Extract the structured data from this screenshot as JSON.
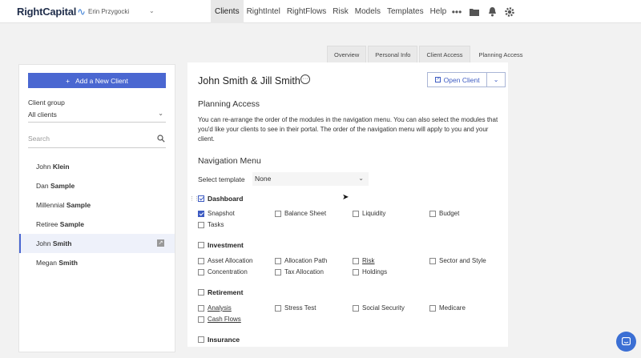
{
  "app": {
    "logo": "RightCapital",
    "user": "Erin Przygocki"
  },
  "nav": {
    "items": [
      "Clients",
      "RightIntel",
      "RightFlows",
      "Risk",
      "Models",
      "Templates",
      "Help"
    ],
    "active": "Clients",
    "icons": [
      "more-icon",
      "folder-icon",
      "bell-icon",
      "gear-icon"
    ]
  },
  "tabs": [
    "Overview",
    "Personal Info",
    "Client Access",
    "Planning Access"
  ],
  "active_tab": "Planning Access",
  "sidebar": {
    "add_button": "Add a New Client",
    "client_group_label": "Client group",
    "client_group_value": "All clients",
    "search_placeholder": "Search",
    "clients": [
      {
        "first": "John",
        "last": "Klein"
      },
      {
        "first": "Dan",
        "last": "Sample"
      },
      {
        "first": "Millennial",
        "last": "Sample"
      },
      {
        "first": "Retiree",
        "last": "Sample"
      },
      {
        "first": "John",
        "last": "Smith",
        "active": true
      },
      {
        "first": "Megan",
        "last": "Smith"
      }
    ]
  },
  "main": {
    "client_name": "John Smith & Jill Smith",
    "open_client": "Open Client",
    "planning_access_title": "Planning Access",
    "planning_access_desc": "You can re-arrange the order of the modules in the navigation menu. You can also select the modules that you'd like your clients to see in their portal. The order of the navigation menu will apply to you and your client.",
    "nav_menu_title": "Navigation Menu",
    "select_template_label": "Select template",
    "select_template_value": "None",
    "sections": [
      {
        "name": "Dashboard",
        "checked": true,
        "modules": [
          {
            "label": "Snapshot",
            "checked": true
          },
          {
            "label": "Balance Sheet",
            "checked": false
          },
          {
            "label": "Liquidity",
            "checked": false
          },
          {
            "label": "Budget",
            "checked": false
          },
          {
            "label": "Tasks",
            "checked": false
          }
        ]
      },
      {
        "name": "Investment",
        "checked": false,
        "modules": [
          {
            "label": "Asset Allocation",
            "checked": false
          },
          {
            "label": "Allocation Path",
            "checked": false
          },
          {
            "label": "Risk",
            "checked": false,
            "link": true
          },
          {
            "label": "Sector and Style",
            "checked": false
          },
          {
            "label": "Concentration",
            "checked": false
          },
          {
            "label": "Tax Allocation",
            "checked": false
          },
          {
            "label": "Holdings",
            "checked": false
          }
        ]
      },
      {
        "name": "Retirement",
        "checked": false,
        "modules": [
          {
            "label": "Analysis",
            "checked": false,
            "link": true
          },
          {
            "label": "Stress Test",
            "checked": false
          },
          {
            "label": "Social Security",
            "checked": false
          },
          {
            "label": "Medicare",
            "checked": false
          },
          {
            "label": "Cash Flows",
            "checked": false,
            "link": true
          }
        ]
      },
      {
        "name": "Insurance",
        "checked": false,
        "modules": []
      }
    ]
  }
}
